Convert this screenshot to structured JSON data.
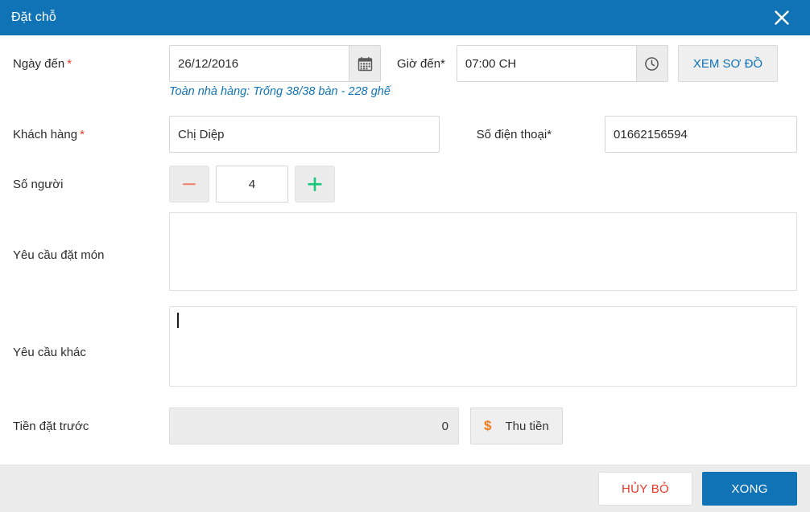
{
  "dialog": {
    "title": "Đặt chỗ",
    "close_icon": "close-icon"
  },
  "colors": {
    "header_blue": "#1073b5",
    "accent_blue": "#1073b5",
    "required_red": "#e8392b",
    "cancel_red": "#e8392b",
    "plus_green": "#16c77a",
    "minus_salmon": "#f08a74",
    "money_orange": "#ee7b1d",
    "field_border": "#d6d6d6",
    "footer_bg": "#ececec"
  },
  "form": {
    "arrival_date": {
      "label": "Ngày đến",
      "required_mark": "*",
      "value": "26/12/2016",
      "placeholder": "dd/mm/yyyy",
      "icon": "calendar-icon"
    },
    "arrival_time": {
      "label": "Giờ đến",
      "required_mark": "*",
      "value": "07:00 CH",
      "placeholder": "hh:mm",
      "icon": "clock-icon"
    },
    "view_map_button": "XEM SƠ ĐỒ",
    "status_text": "Toàn nhà hàng: Trống 38/38 bàn - 228 ghế",
    "customer": {
      "label": "Khách hàng",
      "required_mark": "*",
      "value": "Chị Diệp",
      "placeholder": ""
    },
    "phone": {
      "label": "Số điện thoại",
      "required_mark": "*",
      "value": "01662156594",
      "placeholder": ""
    },
    "people": {
      "label": "Số người",
      "value": "4",
      "decrement_icon": "minus-icon",
      "increment_icon": "plus-icon"
    },
    "food_request": {
      "label": "Yêu cầu đặt món",
      "value": "",
      "placeholder": ""
    },
    "other_request": {
      "label": "Yêu cầu khác",
      "value": "",
      "placeholder": ""
    },
    "deposit": {
      "label": "Tiền đặt trước",
      "value": "0",
      "placeholder": "",
      "collect_button": "Thu tiền",
      "collect_icon": "dollar-icon"
    }
  },
  "footer": {
    "cancel_label": "HỦY BỎ",
    "confirm_label": "XONG"
  }
}
